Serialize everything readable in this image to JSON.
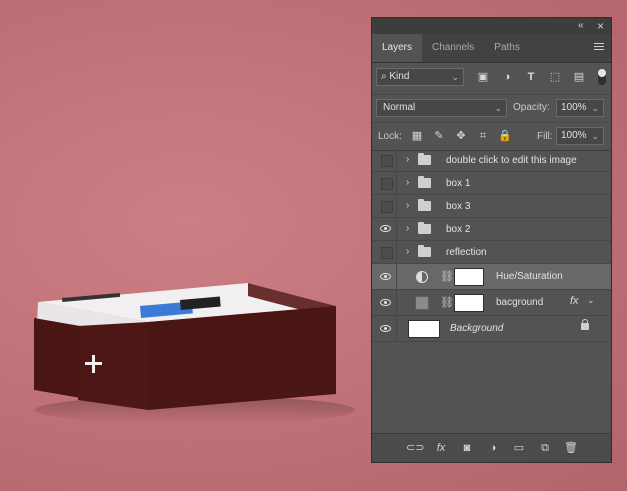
{
  "panel": {
    "tabs": [
      {
        "label": "Layers",
        "active": true
      },
      {
        "label": "Channels",
        "active": false
      },
      {
        "label": "Paths",
        "active": false
      }
    ],
    "collapse_glyph": "«",
    "close_glyph": "×",
    "filter": {
      "kind_label": "Kind",
      "icons": [
        "image-filter-icon",
        "adjustment-filter-icon",
        "type-filter-icon",
        "shape-filter-icon",
        "smart-object-filter-icon"
      ]
    },
    "blend_mode": "Normal",
    "opacity_label": "Opacity:",
    "opacity_value": "100%",
    "lock_label": "Lock:",
    "fill_label": "Fill:",
    "fill_value": "100%",
    "fx_label": "fx"
  },
  "layers": [
    {
      "name": "double click to edit this image",
      "type": "group",
      "visible": false
    },
    {
      "name": "box 1",
      "type": "group",
      "visible": false
    },
    {
      "name": "box 3",
      "type": "group",
      "visible": false
    },
    {
      "name": "box 2",
      "type": "group",
      "visible": true
    },
    {
      "name": "reflection",
      "type": "group",
      "visible": false
    },
    {
      "name": "Hue/Saturation",
      "type": "adjustment",
      "visible": true,
      "selected": true
    },
    {
      "name": "bacground",
      "type": "fill",
      "visible": true,
      "fx": true
    },
    {
      "name": "Background",
      "type": "background",
      "visible": true,
      "locked": true
    }
  ],
  "colors": {
    "canvas_bg": "#c27379",
    "box_dark": "#4a1614",
    "box_white": "#f2eff0",
    "panel_bg": "#535353",
    "selected_row": "#686868"
  }
}
